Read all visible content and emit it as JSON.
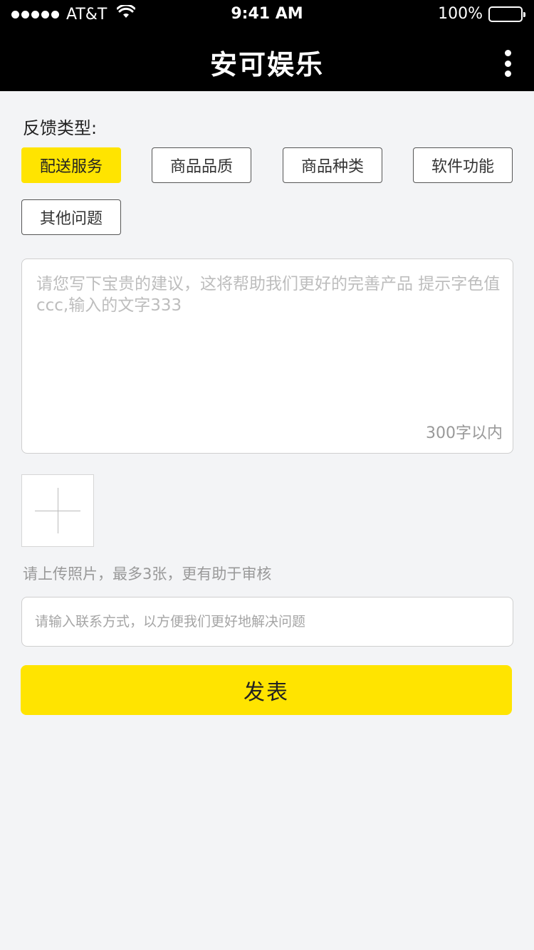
{
  "status_bar": {
    "carrier": "AT&T",
    "time": "9:41 AM",
    "battery": "100%"
  },
  "nav": {
    "title": "安可娱乐"
  },
  "feedback": {
    "label": "反馈类型:",
    "types": [
      {
        "label": "配送服务",
        "selected": true
      },
      {
        "label": "商品品质",
        "selected": false
      },
      {
        "label": "商品种类",
        "selected": false
      },
      {
        "label": "软件功能",
        "selected": false
      },
      {
        "label": "其他问题",
        "selected": false
      }
    ],
    "placeholder": "请您写下宝贵的建议，这将帮助我们更好的完善产品 提示字色值ccc,输入的文字333",
    "limit": "300字以内"
  },
  "upload": {
    "hint": "请上传照片，最多3张，更有助于审核"
  },
  "contact": {
    "placeholder": "请输入联系方式，以方便我们更好地解决问题"
  },
  "submit": {
    "label": "发表"
  },
  "colors": {
    "accent": "#ffe400",
    "header": "#000000",
    "background": "#f3f4f6"
  }
}
